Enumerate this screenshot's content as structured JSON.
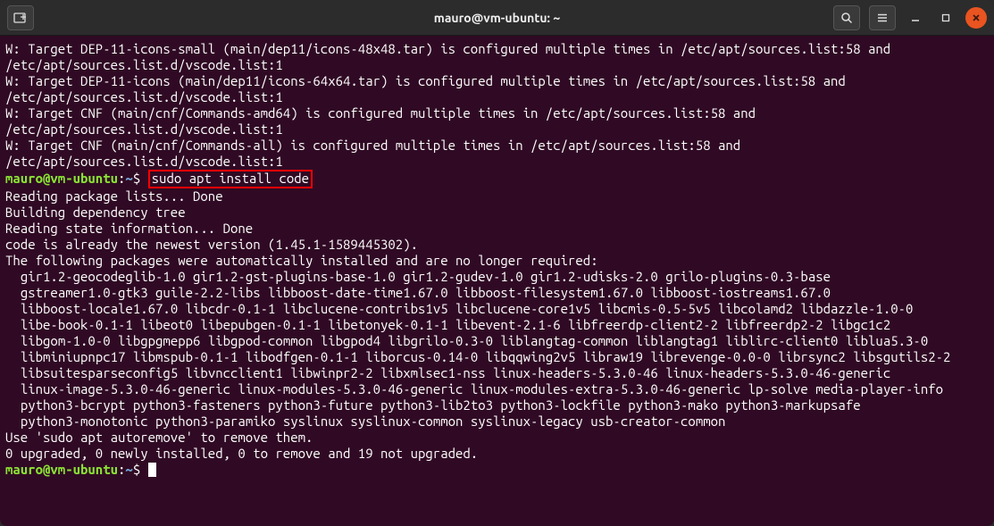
{
  "titlebar": {
    "title": "mauro@vm-ubuntu: ~"
  },
  "prompt": {
    "user_host": "mauro@vm-ubuntu",
    "path": "~",
    "symbol": "$"
  },
  "command": "sudo apt install code",
  "output_before": "W: Target DEP-11-icons-small (main/dep11/icons-48x48.tar) is configured multiple times in /etc/apt/sources.list:58 and /etc/apt/sources.list.d/vscode.list:1\nW: Target DEP-11-icons (main/dep11/icons-64x64.tar) is configured multiple times in /etc/apt/sources.list:58 and /etc/apt/sources.list.d/vscode.list:1\nW: Target CNF (main/cnf/Commands-amd64) is configured multiple times in /etc/apt/sources.list:58 and /etc/apt/sources.list.d/vscode.list:1\nW: Target CNF (main/cnf/Commands-all) is configured multiple times in /etc/apt/sources.list:58 and /etc/apt/sources.list.d/vscode.list:1",
  "output_after": "Reading package lists... Done\nBuilding dependency tree\nReading state information... Done\ncode is already the newest version (1.45.1-1589445302).\nThe following packages were automatically installed and are no longer required:\n  gir1.2-geocodeglib-1.0 gir1.2-gst-plugins-base-1.0 gir1.2-gudev-1.0 gir1.2-udisks-2.0 grilo-plugins-0.3-base\n  gstreamer1.0-gtk3 guile-2.2-libs libboost-date-time1.67.0 libboost-filesystem1.67.0 libboost-iostreams1.67.0\n  libboost-locale1.67.0 libcdr-0.1-1 libclucene-contribs1v5 libclucene-core1v5 libcmis-0.5-5v5 libcolamd2 libdazzle-1.0-0\n  libe-book-0.1-1 libeot0 libepubgen-0.1-1 libetonyek-0.1-1 libevent-2.1-6 libfreerdp-client2-2 libfreerdp2-2 libgc1c2\n  libgom-1.0-0 libgpgmepp6 libgpod-common libgpod4 libgrilo-0.3-0 liblangtag-common liblangtag1 liblirc-client0 liblua5.3-0\n  libminiupnpc17 libmspub-0.1-1 libodfgen-0.1-1 liborcus-0.14-0 libqqwing2v5 libraw19 librevenge-0.0-0 librsync2 libsgutils2-2\n  libsuitesparseconfig5 libvncclient1 libwinpr2-2 libxmlsec1-nss linux-headers-5.3.0-46 linux-headers-5.3.0-46-generic\n  linux-image-5.3.0-46-generic linux-modules-5.3.0-46-generic linux-modules-extra-5.3.0-46-generic lp-solve media-player-info\n  python3-bcrypt python3-fasteners python3-future python3-lib2to3 python3-lockfile python3-mako python3-markupsafe\n  python3-monotonic python3-paramiko syslinux syslinux-common syslinux-legacy usb-creator-common\nUse 'sudo apt autoremove' to remove them.\n0 upgraded, 0 newly installed, 0 to remove and 19 not upgraded."
}
